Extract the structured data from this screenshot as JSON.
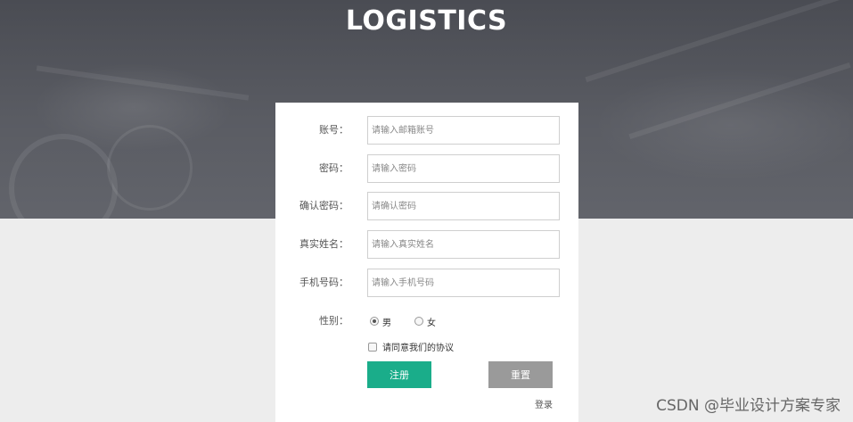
{
  "header": {
    "title": "LOGISTICS"
  },
  "form": {
    "fields": [
      {
        "label": "账号：",
        "placeholder": "请输入邮箱账号",
        "value": ""
      },
      {
        "label": "密码：",
        "placeholder": "请输入密码",
        "value": ""
      },
      {
        "label": "确认密码：",
        "placeholder": "请确认密码",
        "value": ""
      },
      {
        "label": "真实姓名：",
        "placeholder": "请输入真实姓名",
        "value": ""
      },
      {
        "label": "手机号码：",
        "placeholder": "请输入手机号码",
        "value": ""
      }
    ],
    "gender": {
      "label": "性别：",
      "options": [
        "男",
        "女"
      ],
      "selected": "男"
    },
    "agree_label": "请同意我们的协议",
    "register_label": "注册",
    "reset_label": "重置",
    "login_link": "登录"
  },
  "watermark": "CSDN @毕业设计方案专家",
  "colors": {
    "register_button": "#1aad8a",
    "reset_button": "#9a9a9a",
    "background": "#ededed"
  }
}
